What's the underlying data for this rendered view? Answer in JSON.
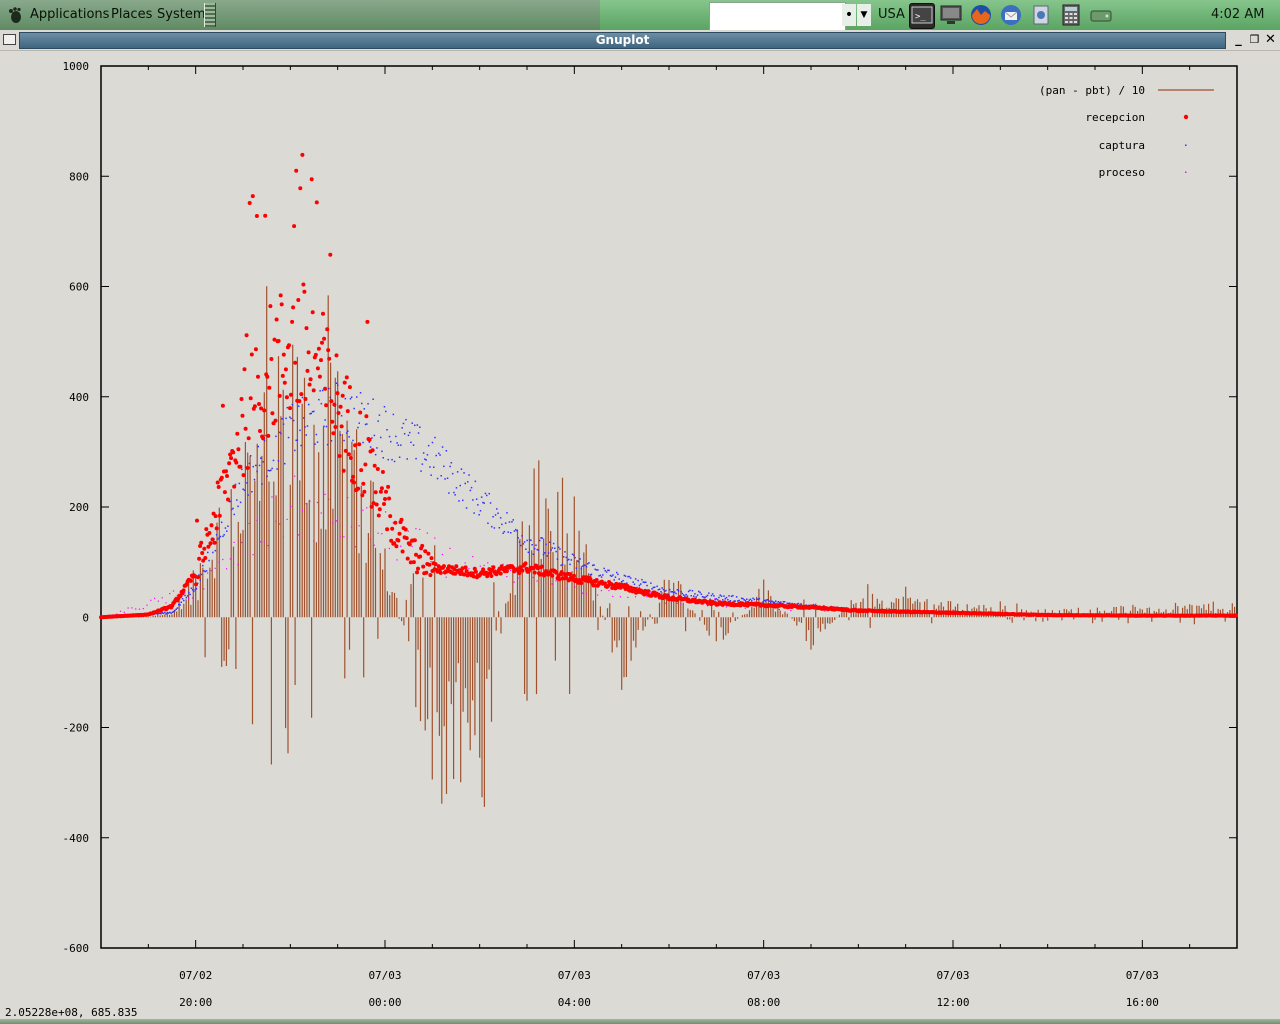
{
  "top_panel": {
    "menus": [
      "Applications",
      "Places",
      "System"
    ],
    "search_placeholder": "",
    "search_dot": "•",
    "keyboard_layout": "USA",
    "clock": "4:02 AM",
    "launchers": [
      "terminal-icon",
      "monitor-icon",
      "firefox-icon",
      "thunderbird-icon",
      "settings-icon",
      "calculator-icon",
      "drive-icon"
    ]
  },
  "window": {
    "title": "Gnuplot",
    "buttons": [
      "minimize",
      "maximize",
      "close"
    ]
  },
  "status": {
    "coordinates": "2.05228e+08,  685.835"
  },
  "chart_data": {
    "type": "line",
    "ylim": [
      -600,
      1000
    ],
    "y_ticks": [
      1000,
      800,
      600,
      400,
      200,
      0,
      -200,
      -400,
      -600
    ],
    "y_tick_labels": [
      "1000",
      "800",
      "600",
      "400",
      "200",
      "0",
      "-200",
      "-400",
      "-600"
    ],
    "x_tick_labels": [
      {
        "date": "07/02",
        "time": "20:00"
      },
      {
        "date": "07/03",
        "time": "00:00"
      },
      {
        "date": "07/03",
        "time": "04:00"
      },
      {
        "date": "07/03",
        "time": "08:00"
      },
      {
        "date": "07/03",
        "time": "12:00"
      },
      {
        "date": "07/03",
        "time": "16:00"
      }
    ],
    "x_range_hours": [
      "07/02 18:00",
      "07/03 18:00"
    ],
    "grid": false,
    "legend": "top-right",
    "colors": {
      "diff": "#a0522d",
      "recepcion": "#ff0000",
      "captura": "#3333ff",
      "proceso": "#ff00ff"
    },
    "series": [
      {
        "name": "(pan - pbt) / 10",
        "style": "impulses",
        "samples_per_hour": 20,
        "envelope": [
          {
            "t": "18:00",
            "y": 0
          },
          {
            "t": "19:30",
            "y": 5
          },
          {
            "t": "20:00",
            "y": 90
          },
          {
            "t": "21:00",
            "y": 300
          },
          {
            "t": "22:00",
            "y": 430
          },
          {
            "t": "23:00",
            "y": 380
          },
          {
            "t": "00:00",
            "y": 150
          },
          {
            "t": "01:00",
            "y": -300
          },
          {
            "t": "02:00",
            "y": -250
          },
          {
            "t": "03:00",
            "y": 250
          },
          {
            "t": "04:00",
            "y": 200
          },
          {
            "t": "05:00",
            "y": -120
          },
          {
            "t": "06:00",
            "y": 90
          },
          {
            "t": "07:00",
            "y": -60
          },
          {
            "t": "08:00",
            "y": 60
          },
          {
            "t": "09:00",
            "y": -50
          },
          {
            "t": "10:00",
            "y": 40
          },
          {
            "t": "12:00",
            "y": 25
          },
          {
            "t": "14:00",
            "y": 12
          },
          {
            "t": "16:00",
            "y": 20
          },
          {
            "t": "18:00",
            "y": 25
          }
        ]
      },
      {
        "name": "recepcion",
        "style": "points",
        "values": [
          {
            "t": "18:00",
            "y": 0
          },
          {
            "t": "19:00",
            "y": 5
          },
          {
            "t": "19:30",
            "y": 20
          },
          {
            "t": "20:00",
            "y": 80
          },
          {
            "t": "20:30",
            "y": 200
          },
          {
            "t": "21:00",
            "y": 350
          },
          {
            "t": "21:30",
            "y": 440
          },
          {
            "t": "22:00",
            "y": 490
          },
          {
            "t": "22:30",
            "y": 470
          },
          {
            "t": "23:00",
            "y": 380
          },
          {
            "t": "23:30",
            "y": 300
          },
          {
            "t": "00:00",
            "y": 200
          },
          {
            "t": "00:30",
            "y": 120
          },
          {
            "t": "01:00",
            "y": 90
          },
          {
            "t": "02:00",
            "y": 80
          },
          {
            "t": "03:00",
            "y": 90
          },
          {
            "t": "04:00",
            "y": 70
          },
          {
            "t": "05:00",
            "y": 55
          },
          {
            "t": "06:00",
            "y": 35
          },
          {
            "t": "07:00",
            "y": 25
          },
          {
            "t": "08:00",
            "y": 22
          },
          {
            "t": "09:00",
            "y": 18
          },
          {
            "t": "10:00",
            "y": 12
          },
          {
            "t": "12:00",
            "y": 8
          },
          {
            "t": "14:00",
            "y": 4
          },
          {
            "t": "16:00",
            "y": 3
          },
          {
            "t": "18:00",
            "y": 3
          }
        ]
      },
      {
        "name": "captura",
        "style": "dots",
        "values": [
          {
            "t": "18:00",
            "y": 0
          },
          {
            "t": "19:30",
            "y": 10
          },
          {
            "t": "20:00",
            "y": 60
          },
          {
            "t": "21:00",
            "y": 250
          },
          {
            "t": "22:00",
            "y": 340
          },
          {
            "t": "23:00",
            "y": 375
          },
          {
            "t": "00:00",
            "y": 340
          },
          {
            "t": "01:00",
            "y": 290
          },
          {
            "t": "02:00",
            "y": 210
          },
          {
            "t": "03:00",
            "y": 140
          },
          {
            "t": "04:00",
            "y": 100
          },
          {
            "t": "05:00",
            "y": 70
          },
          {
            "t": "06:00",
            "y": 48
          },
          {
            "t": "07:00",
            "y": 38
          },
          {
            "t": "08:00",
            "y": 30
          },
          {
            "t": "09:00",
            "y": 22
          },
          {
            "t": "10:00",
            "y": 14
          },
          {
            "t": "12:00",
            "y": 8
          },
          {
            "t": "14:00",
            "y": 5
          },
          {
            "t": "16:00",
            "y": 3
          },
          {
            "t": "18:00",
            "y": 3
          }
        ]
      },
      {
        "name": "proceso",
        "style": "dots",
        "values": [
          {
            "t": "18:00",
            "y": 0
          },
          {
            "t": "20:00",
            "y": 50
          },
          {
            "t": "22:00",
            "y": 200
          },
          {
            "t": "00:00",
            "y": 150
          },
          {
            "t": "02:00",
            "y": 80
          },
          {
            "t": "04:00",
            "y": 60
          },
          {
            "t": "06:00",
            "y": 35
          },
          {
            "t": "08:00",
            "y": 20
          },
          {
            "t": "12:00",
            "y": 8
          },
          {
            "t": "18:00",
            "y": 3
          }
        ]
      }
    ]
  }
}
